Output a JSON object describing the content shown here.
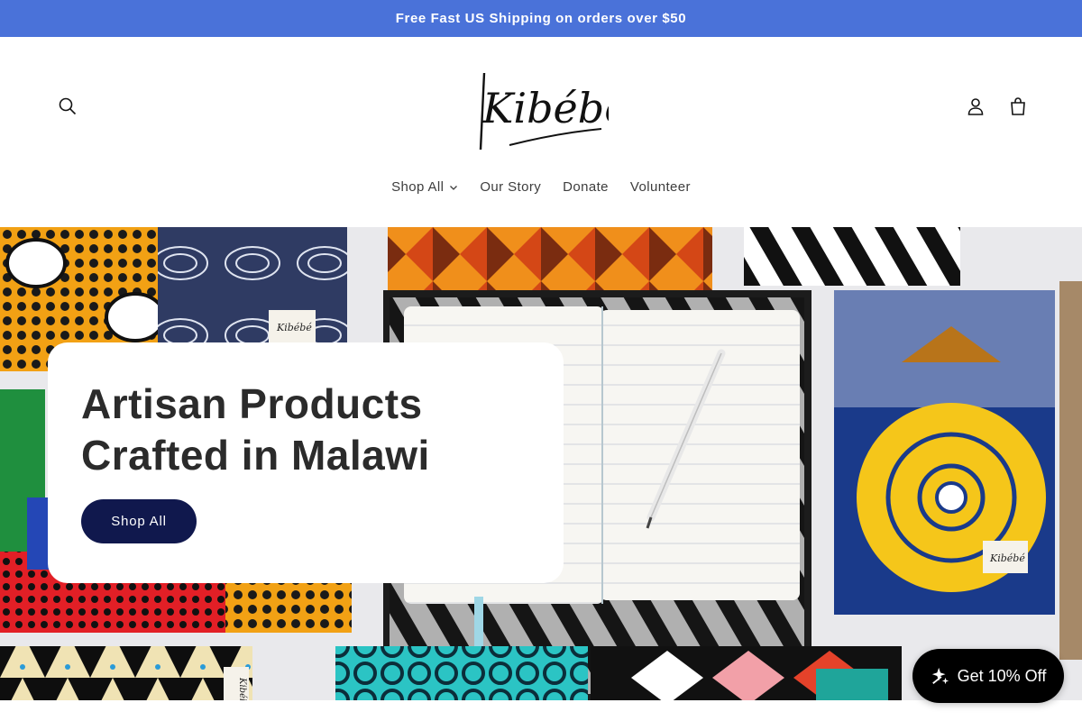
{
  "announcement": {
    "text": "Free Fast US Shipping on orders over $50"
  },
  "header": {
    "logo_text": "Kibébé",
    "icons": {
      "search": "search-icon",
      "account": "account-icon",
      "cart": "cart-icon"
    }
  },
  "nav": {
    "items": [
      {
        "label": "Shop All",
        "has_dropdown": true
      },
      {
        "label": "Our Story"
      },
      {
        "label": "Donate"
      },
      {
        "label": "Volunteer"
      }
    ]
  },
  "hero": {
    "heading": "Artisan Products Crafted in Malawi",
    "button_label": "Shop All",
    "label_tags": [
      "Kibébé",
      "Kibébé",
      "Kibébé"
    ]
  },
  "discount_widget": {
    "label": "Get 10% Off",
    "icon": "sparkle-icon"
  },
  "colors": {
    "announcement_bg": "#4a72d9",
    "button_bg": "#10184d",
    "widget_bg": "#000000"
  }
}
